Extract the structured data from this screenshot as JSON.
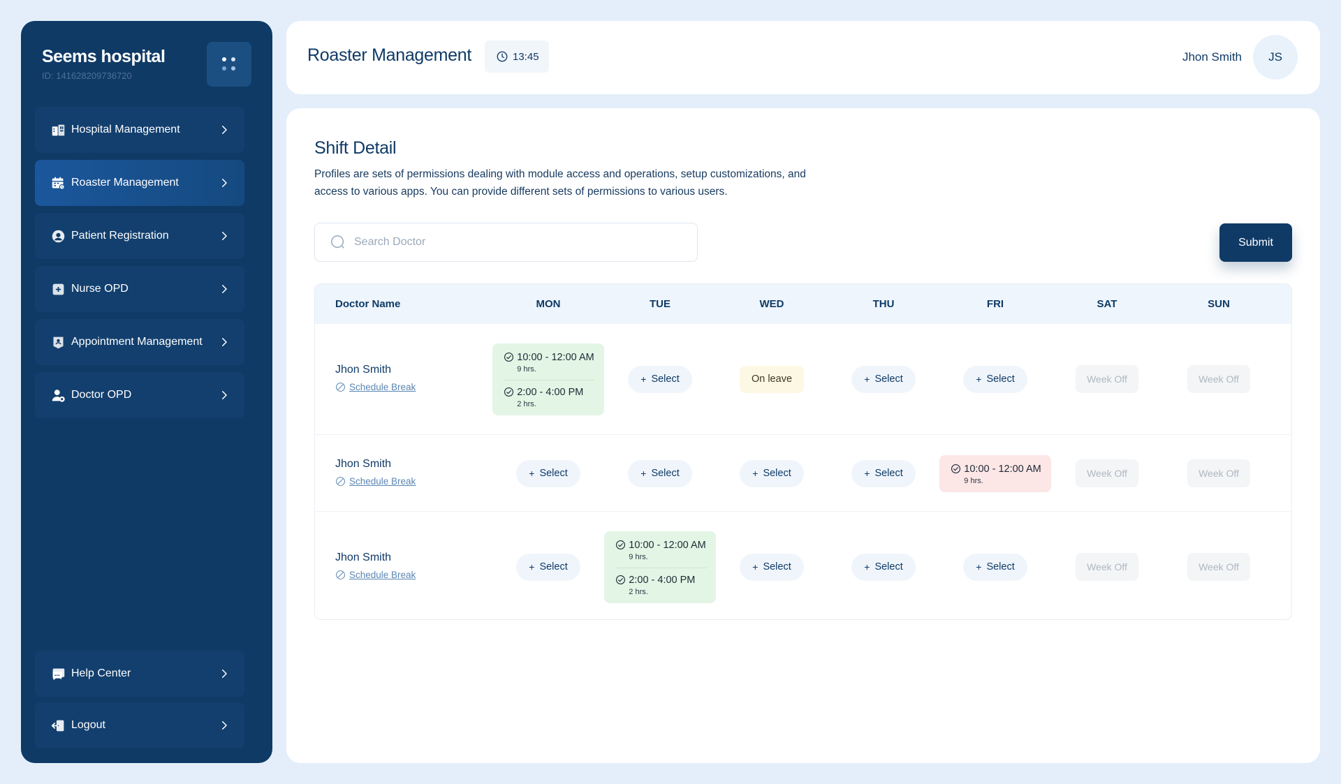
{
  "app": {
    "name": "Seems hospital",
    "id_text": "ID: 141628209736720"
  },
  "sidebar": {
    "items": [
      {
        "label": "Hospital Management",
        "icon": "building-icon"
      },
      {
        "label": "Roaster Management",
        "icon": "calendar-icon",
        "active": true
      },
      {
        "label": "Patient Registration",
        "icon": "user-circle-icon"
      },
      {
        "label": "Nurse OPD",
        "icon": "plus-square-icon"
      },
      {
        "label": "Appointment Management",
        "icon": "id-badge-icon"
      },
      {
        "label": "Doctor OPD",
        "icon": "user-gear-icon"
      }
    ],
    "footer": [
      {
        "label": "Help Center",
        "icon": "chat-icon"
      },
      {
        "label": "Logout",
        "icon": "logout-icon"
      }
    ]
  },
  "header": {
    "title": "Roaster Management",
    "time": "13:45",
    "user_name": "Jhon Smith",
    "initials": "JS"
  },
  "main": {
    "title": "Shift Detail",
    "description": "Profiles are sets of permissions dealing with module access and operations, setup customizations, and access to various apps. You can provide different sets of permissions to various users.",
    "search_placeholder": "Search Doctor",
    "submit_label": "Submit"
  },
  "table": {
    "columns": [
      "Doctor Name",
      "MON",
      "TUE",
      "WED",
      "THU",
      "FRI",
      "SAT",
      "SUN"
    ],
    "break_label": "Schedule Break",
    "select_label": "Select",
    "leave_label": "On leave",
    "weekoff_label": "Week Off",
    "rows": [
      {
        "doctor": "Jhon Smith",
        "cells": [
          {
            "type": "shift",
            "color": "green",
            "slots": [
              {
                "time": "10:00 - 12:00 AM",
                "hrs": "9 hrs."
              },
              {
                "time": "2:00 - 4:00 PM",
                "hrs": "2 hrs."
              }
            ]
          },
          {
            "type": "select"
          },
          {
            "type": "leave"
          },
          {
            "type": "select"
          },
          {
            "type": "select"
          },
          {
            "type": "weekoff"
          },
          {
            "type": "weekoff"
          }
        ]
      },
      {
        "doctor": "Jhon Smith",
        "cells": [
          {
            "type": "select"
          },
          {
            "type": "select"
          },
          {
            "type": "select"
          },
          {
            "type": "select"
          },
          {
            "type": "shift",
            "color": "red",
            "slots": [
              {
                "time": "10:00 - 12:00 AM",
                "hrs": "9 hrs."
              }
            ]
          },
          {
            "type": "weekoff"
          },
          {
            "type": "weekoff"
          }
        ]
      },
      {
        "doctor": "Jhon Smith",
        "cells": [
          {
            "type": "select"
          },
          {
            "type": "shift",
            "color": "green",
            "slots": [
              {
                "time": "10:00 - 12:00 AM",
                "hrs": "9 hrs."
              },
              {
                "time": "2:00 - 4:00 PM",
                "hrs": "2 hrs."
              }
            ]
          },
          {
            "type": "select"
          },
          {
            "type": "select"
          },
          {
            "type": "select"
          },
          {
            "type": "weekoff"
          },
          {
            "type": "weekoff"
          }
        ]
      }
    ]
  },
  "colors": {
    "primary": "#0f3a66",
    "background": "#e3eefa",
    "shift_green": "#e3f5e5",
    "shift_red": "#fce6e6",
    "leave_yellow": "#fdf8e3"
  }
}
